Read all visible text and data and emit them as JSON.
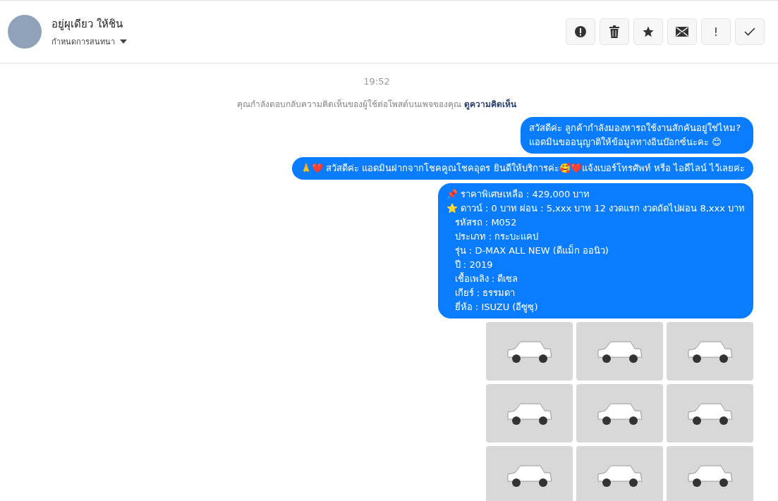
{
  "header": {
    "name": "อยู่ผุเดียว ให้ชิน",
    "subtitle": "กำหนดการสนทนา",
    "actions": [
      {
        "kind": "alert"
      },
      {
        "kind": "trash"
      },
      {
        "kind": "star"
      },
      {
        "kind": "mail"
      },
      {
        "kind": "exclaim",
        "label": "!"
      },
      {
        "kind": "check"
      }
    ]
  },
  "thread": {
    "time": "19:52",
    "notice": "คุณกำลังตอบกลับความคิดเห็นของผู้ใช้ต่อโพสต์บนเพจของคุณ",
    "notice_link": "ดูความคิดเห็น",
    "messages": [
      {
        "lines": [
          {
            "text": "สวัสดีค่ะ ลูกค้ากำลังมองหารถใช้งานสักคันอยู่ใช่ไหม? แอดมินขออนุญาติให้ข้อมูลทางอินบ๊อกซ์นะคะ 😊",
            "indent": false
          }
        ]
      },
      {
        "lines": [
          {
            "text": "🙏❤️ สวัสดีค่ะ แอดมินฝากจากโชคคูณโชคอุดร ยินดีให้บริการค่ะ🥰❤️แจ้งเบอร์โทรศัพท์ หรือ ไอดีไลน์  ไว้เลยค่ะ",
            "indent": false
          }
        ]
      },
      {
        "lines": [
          {
            "text": "📌 ราคาพิเศษเหลือ : 429,000 บาท",
            "indent": false
          },
          {
            "text": "⭐ ดาวน์ : 0 บาท ผ่อน : 5,xxx บาท 12 งวดแรก งวดถัดไปผ่อน  8,xxx บาท",
            "indent": false
          },
          {
            "text": "รหัสรถ : M052",
            "indent": true
          },
          {
            "text": "ประเภท : กระบะแคป",
            "indent": true
          },
          {
            "text": "รุ่น : D-MAX ALL NEW (ดีแม็ก ออนิว)",
            "indent": true
          },
          {
            "text": "ปี : 2019",
            "indent": true
          },
          {
            "text": "เชื้อเพลิง : ดีเซล",
            "indent": true
          },
          {
            "text": "เกียร์ : ธรรมดา",
            "indent": true
          },
          {
            "text": "ยี่ห้อ : ISUZU (อีซูซุ)",
            "indent": true
          }
        ]
      }
    ],
    "photos": [
      {
        "kind": "photo"
      },
      {
        "kind": "photo"
      },
      {
        "kind": "photo"
      },
      {
        "kind": "photo"
      },
      {
        "kind": "photo"
      },
      {
        "kind": "photo"
      },
      {
        "kind": "photo"
      },
      {
        "kind": "photo"
      },
      {
        "kind": "photo"
      }
    ]
  }
}
